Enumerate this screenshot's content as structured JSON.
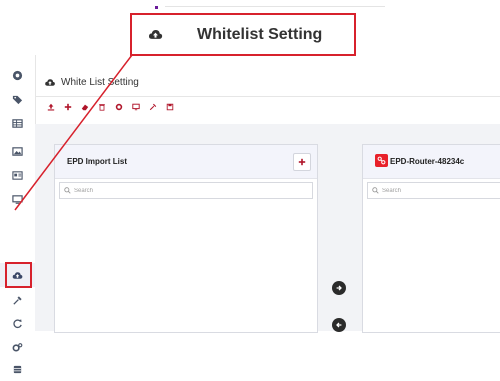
{
  "callout": {
    "title": "Whitelist Setting",
    "icon": "cloud-upload-icon"
  },
  "header": {
    "title": "White List Setting",
    "icon": "cloud-upload-icon"
  },
  "sidebar": {
    "items": [
      {
        "icon": "dashboard-icon"
      },
      {
        "icon": "tags-icon"
      },
      {
        "icon": "table-icon"
      },
      {
        "icon": "image-icon"
      },
      {
        "icon": "id-card-icon"
      },
      {
        "icon": "monitor-icon"
      },
      {
        "icon": "cloud-upload-icon",
        "active": true
      },
      {
        "icon": "satellite-icon"
      },
      {
        "icon": "refresh-icon"
      },
      {
        "icon": "cogs-icon"
      },
      {
        "icon": "database-icon"
      }
    ]
  },
  "toolbar": {
    "buttons": [
      {
        "icon": "upload-icon"
      },
      {
        "icon": "plus-icon"
      },
      {
        "icon": "eraser-icon"
      },
      {
        "icon": "trash-icon"
      },
      {
        "icon": "gear-icon"
      },
      {
        "icon": "monitor-icon"
      },
      {
        "icon": "satellite-icon"
      },
      {
        "icon": "save-icon"
      }
    ]
  },
  "left_panel": {
    "title": "EPD Import List",
    "search_placeholder": "Search"
  },
  "right_panel": {
    "title": "EPD-Router-48234c",
    "search_placeholder": "Search"
  },
  "colors": {
    "accent": "#d7212c",
    "icon": "#3a4767",
    "text": "#333333",
    "panel_header": "#f3f4fb"
  }
}
